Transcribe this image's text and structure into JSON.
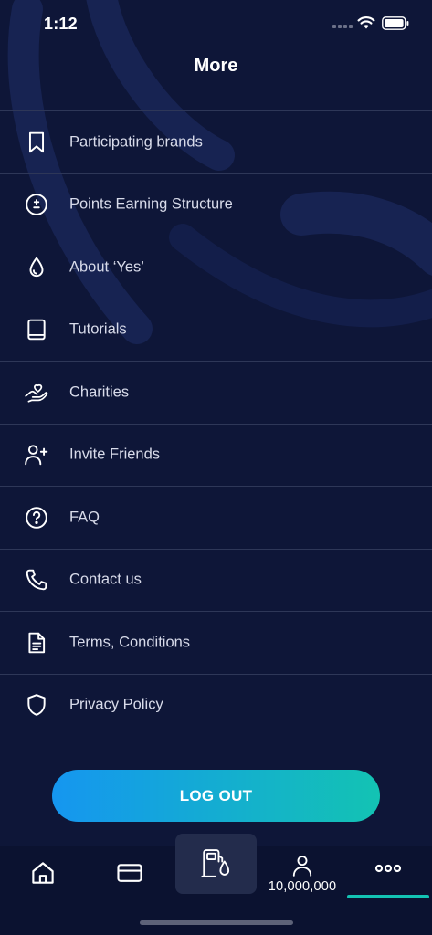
{
  "status_bar": {
    "time": "1:12"
  },
  "header": {
    "title": "More"
  },
  "menu": {
    "items": [
      {
        "label": "Participating brands",
        "icon": "bookmark-icon"
      },
      {
        "label": "Points Earning Structure",
        "icon": "plus-minus-icon"
      },
      {
        "label": "About ‘Yes’",
        "icon": "drop-icon"
      },
      {
        "label": "Tutorials",
        "icon": "book-icon"
      },
      {
        "label": "Charities",
        "icon": "heart-hand-icon"
      },
      {
        "label": "Invite Friends",
        "icon": "add-user-icon"
      },
      {
        "label": "FAQ",
        "icon": "question-icon"
      },
      {
        "label": "Contact us",
        "icon": "phone-icon"
      },
      {
        "label": "Terms, Conditions",
        "icon": "document-icon"
      },
      {
        "label": "Privacy Policy",
        "icon": "shield-icon"
      }
    ]
  },
  "logout": {
    "label": "LOG OUT"
  },
  "bottom_nav": {
    "points": "10,000,000",
    "active_tab": "more",
    "accent_color": "#13c3b3"
  },
  "colors": {
    "background": "#0e1638",
    "button_gradient_start": "#1596f0",
    "button_gradient_end": "#13c3b3",
    "divider": "#2e3758"
  }
}
